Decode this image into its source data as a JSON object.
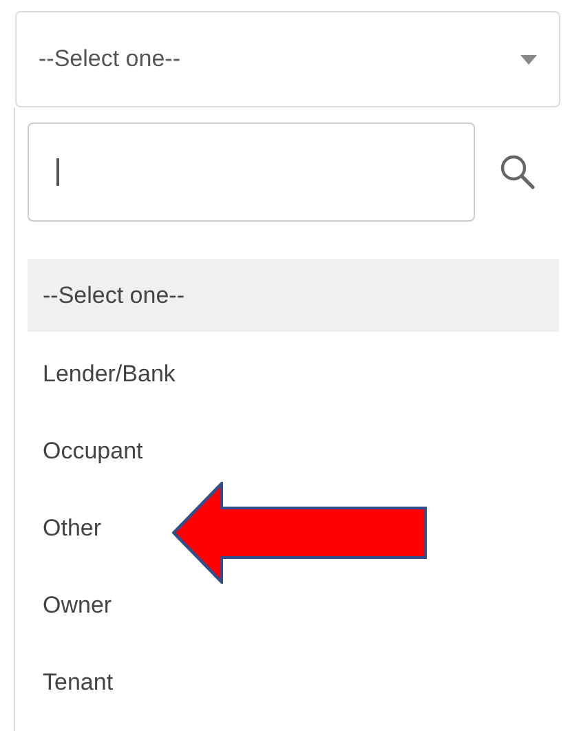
{
  "select": {
    "value": "--Select one--",
    "expanded": true
  },
  "search": {
    "has_cursor": true
  },
  "options": [
    {
      "label": "--Select one--",
      "selected": true
    },
    {
      "label": "Lender/Bank",
      "selected": false
    },
    {
      "label": "Occupant",
      "selected": false
    },
    {
      "label": "Other",
      "selected": false,
      "pointed": true
    },
    {
      "label": "Owner",
      "selected": false
    },
    {
      "label": "Tenant",
      "selected": false
    }
  ]
}
